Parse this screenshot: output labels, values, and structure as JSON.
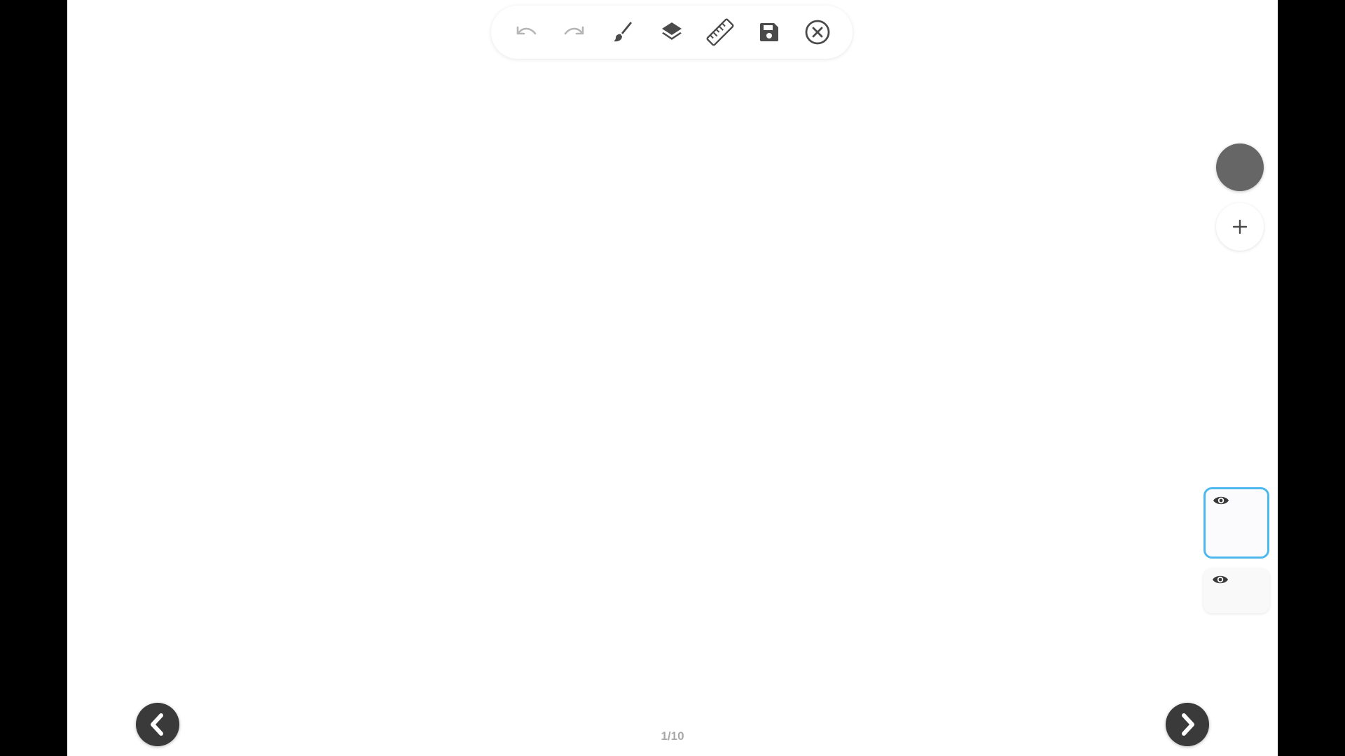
{
  "toolbar": {
    "tools": [
      {
        "name": "undo",
        "icon": "undo-icon",
        "enabled": false
      },
      {
        "name": "redo",
        "icon": "redo-icon",
        "enabled": false
      },
      {
        "name": "brush",
        "icon": "brush-icon",
        "enabled": true
      },
      {
        "name": "layers",
        "icon": "layers-icon",
        "enabled": true
      },
      {
        "name": "ruler",
        "icon": "ruler-icon",
        "enabled": true
      },
      {
        "name": "save",
        "icon": "save-icon",
        "enabled": true
      },
      {
        "name": "close",
        "icon": "close-circle-icon",
        "enabled": true
      }
    ]
  },
  "colors": {
    "current_color": "#666666",
    "icon_active": "#4a4a4a",
    "icon_disabled": "#b5b5b5",
    "layer_active_border": "#4cb8ee",
    "nav_button": "#3a3a3a"
  },
  "right_panel": {
    "add_icon": "plus-icon",
    "layers": [
      {
        "visible": true,
        "active": true,
        "icon": "eye-icon"
      },
      {
        "visible": true,
        "active": false,
        "icon": "eye-icon"
      }
    ]
  },
  "navigation": {
    "prev_icon": "chevron-left-icon",
    "next_icon": "chevron-right-icon",
    "page_indicator": "1/10"
  }
}
